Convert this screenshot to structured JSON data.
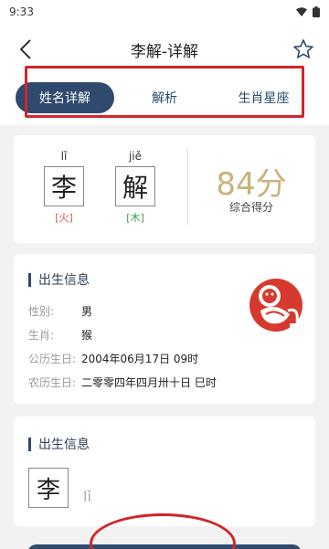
{
  "status_bar": {
    "time": "9:33"
  },
  "header": {
    "title": "李解-详解"
  },
  "tabs": [
    {
      "label": "姓名详解",
      "active": true
    },
    {
      "label": "解析",
      "active": false
    },
    {
      "label": "生肖星座",
      "active": false
    }
  ],
  "name_card": {
    "characters": [
      {
        "char": "李",
        "pinyin": "lǐ",
        "element": "[火]",
        "element_color": "#d9534f"
      },
      {
        "char": "解",
        "pinyin": "jiě",
        "element": "[木]",
        "element_color": "#3a9a4a"
      }
    ],
    "score": "84分",
    "score_label": "综合得分"
  },
  "birth_info": {
    "title": "出生信息",
    "rows": [
      {
        "label": "性别:",
        "value": "男"
      },
      {
        "label": "生肖:",
        "value": "猴"
      },
      {
        "label": "公历生日:",
        "value": "2004年06月17日 09时"
      },
      {
        "label": "农历生日:",
        "value": "二零零四年四月卅十日 巳时"
      }
    ],
    "zodiac_icon": "monkey-seal-icon"
  },
  "char_detail": {
    "title": "出生信息",
    "char": "李",
    "pinyin": "lǐ"
  },
  "colors": {
    "accent": "#2f4a6e",
    "score": "#c9b27a",
    "annotation": "#d2252b"
  }
}
